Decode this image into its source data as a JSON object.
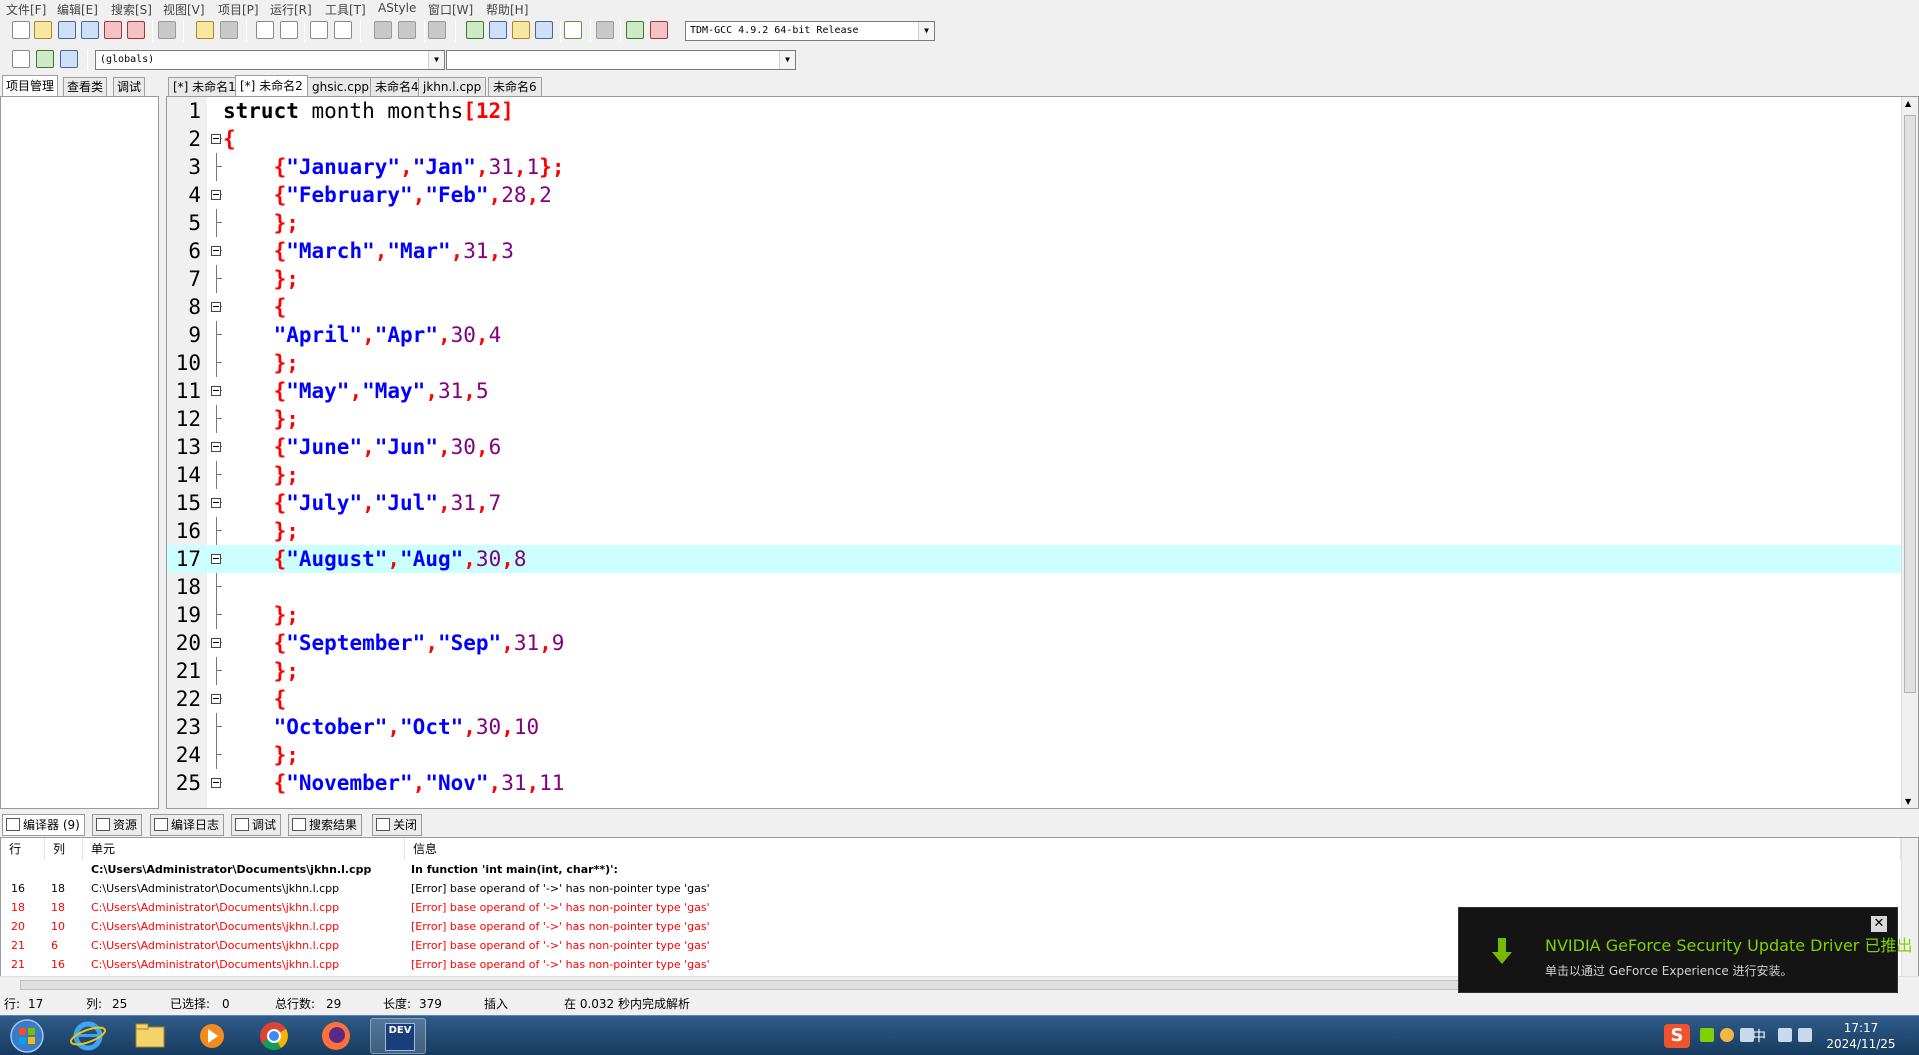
{
  "menu": [
    "文件[F]",
    "编辑[E]",
    "搜索[S]",
    "视图[V]",
    "项目[P]",
    "运行[R]",
    "工具[T]",
    "AStyle",
    "窗口[W]",
    "帮助[H]"
  ],
  "toolbar": {
    "compiler_select": "TDM-GCC 4.9.2 64-bit Release",
    "scope_select": "(globals)",
    "function_select": ""
  },
  "left_tabs": [
    "项目管理",
    "查看类",
    "调试"
  ],
  "editor_tabs": [
    "[*] 未命名1",
    "[*] 未命名2",
    "ghsic.cpp",
    "未命名4",
    "jkhn.l.cpp",
    "未命名6"
  ],
  "editor": {
    "highlight_line": 17,
    "lines": [
      {
        "n": "1",
        "fold": false
      },
      {
        "n": "2",
        "fold": true
      },
      {
        "n": "3",
        "fold": false
      },
      {
        "n": "4",
        "fold": true
      },
      {
        "n": "5",
        "fold": false
      },
      {
        "n": "6",
        "fold": true
      },
      {
        "n": "7",
        "fold": false
      },
      {
        "n": "8",
        "fold": true
      },
      {
        "n": "9",
        "fold": false
      },
      {
        "n": "10",
        "fold": false
      },
      {
        "n": "11",
        "fold": true
      },
      {
        "n": "12",
        "fold": false
      },
      {
        "n": "13",
        "fold": true
      },
      {
        "n": "14",
        "fold": false
      },
      {
        "n": "15",
        "fold": true
      },
      {
        "n": "16",
        "fold": false
      },
      {
        "n": "17",
        "fold": true
      },
      {
        "n": "18",
        "fold": false
      },
      {
        "n": "19",
        "fold": false
      },
      {
        "n": "20",
        "fold": true
      },
      {
        "n": "21",
        "fold": false
      },
      {
        "n": "22",
        "fold": true
      },
      {
        "n": "23",
        "fold": false
      },
      {
        "n": "24",
        "fold": false
      },
      {
        "n": "25",
        "fold": true
      }
    ],
    "code": [
      [
        [
          "kw",
          "struct"
        ],
        [
          "id",
          " month months"
        ],
        [
          "sym",
          "[12]"
        ]
      ],
      [
        [
          "sym",
          "{"
        ]
      ],
      [
        [
          "id",
          "    "
        ],
        [
          "sym",
          "{"
        ],
        [
          "str",
          "\"January\""
        ],
        [
          "sym",
          ","
        ],
        [
          "str",
          "\"Jan\""
        ],
        [
          "sym",
          ","
        ],
        [
          "num",
          "31"
        ],
        [
          "sym",
          ","
        ],
        [
          "num",
          "1"
        ],
        [
          "sym",
          "};"
        ]
      ],
      [
        [
          "id",
          "    "
        ],
        [
          "sym",
          "{"
        ],
        [
          "str",
          "\"February\""
        ],
        [
          "sym",
          ","
        ],
        [
          "str",
          "\"Feb\""
        ],
        [
          "sym",
          ","
        ],
        [
          "num",
          "28"
        ],
        [
          "sym",
          ","
        ],
        [
          "num",
          "2"
        ]
      ],
      [
        [
          "id",
          "    "
        ],
        [
          "sym",
          "};"
        ]
      ],
      [
        [
          "id",
          "    "
        ],
        [
          "sym",
          "{"
        ],
        [
          "str",
          "\"March\""
        ],
        [
          "sym",
          ","
        ],
        [
          "str",
          "\"Mar\""
        ],
        [
          "sym",
          ","
        ],
        [
          "num",
          "31"
        ],
        [
          "sym",
          ","
        ],
        [
          "num",
          "3"
        ]
      ],
      [
        [
          "id",
          "    "
        ],
        [
          "sym",
          "};"
        ]
      ],
      [
        [
          "id",
          "    "
        ],
        [
          "sym",
          "{"
        ]
      ],
      [
        [
          "id",
          "    "
        ],
        [
          "str",
          "\"April\""
        ],
        [
          "sym",
          ","
        ],
        [
          "str",
          "\"Apr\""
        ],
        [
          "sym",
          ","
        ],
        [
          "num",
          "30"
        ],
        [
          "sym",
          ","
        ],
        [
          "num",
          "4"
        ]
      ],
      [
        [
          "id",
          "    "
        ],
        [
          "sym",
          "};"
        ]
      ],
      [
        [
          "id",
          "    "
        ],
        [
          "sym",
          "{"
        ],
        [
          "str",
          "\"May\""
        ],
        [
          "sym",
          ","
        ],
        [
          "str",
          "\"May\""
        ],
        [
          "sym",
          ","
        ],
        [
          "num",
          "31"
        ],
        [
          "sym",
          ","
        ],
        [
          "num",
          "5"
        ]
      ],
      [
        [
          "id",
          "    "
        ],
        [
          "sym",
          "};"
        ]
      ],
      [
        [
          "id",
          "    "
        ],
        [
          "sym",
          "{"
        ],
        [
          "str",
          "\"June\""
        ],
        [
          "sym",
          ","
        ],
        [
          "str",
          "\"Jun\""
        ],
        [
          "sym",
          ","
        ],
        [
          "num",
          "30"
        ],
        [
          "sym",
          ","
        ],
        [
          "num",
          "6"
        ]
      ],
      [
        [
          "id",
          "    "
        ],
        [
          "sym",
          "};"
        ]
      ],
      [
        [
          "id",
          "    "
        ],
        [
          "sym",
          "{"
        ],
        [
          "str",
          "\"July\""
        ],
        [
          "sym",
          ","
        ],
        [
          "str",
          "\"Jul\""
        ],
        [
          "sym",
          ","
        ],
        [
          "num",
          "31"
        ],
        [
          "sym",
          ","
        ],
        [
          "num",
          "7"
        ]
      ],
      [
        [
          "id",
          "    "
        ],
        [
          "sym",
          "};"
        ]
      ],
      [
        [
          "id",
          "    "
        ],
        [
          "sym",
          "{"
        ],
        [
          "str",
          "\"August\""
        ],
        [
          "sym",
          ","
        ],
        [
          "str",
          "\"Aug\""
        ],
        [
          "sym",
          ","
        ],
        [
          "num",
          "30"
        ],
        [
          "sym",
          ","
        ],
        [
          "num",
          "8"
        ]
      ],
      [],
      [
        [
          "id",
          "    "
        ],
        [
          "sym",
          "};"
        ]
      ],
      [
        [
          "id",
          "    "
        ],
        [
          "sym",
          "{"
        ],
        [
          "str",
          "\"September\""
        ],
        [
          "sym",
          ","
        ],
        [
          "str",
          "\"Sep\""
        ],
        [
          "sym",
          ","
        ],
        [
          "num",
          "31"
        ],
        [
          "sym",
          ","
        ],
        [
          "num",
          "9"
        ]
      ],
      [
        [
          "id",
          "    "
        ],
        [
          "sym",
          "};"
        ]
      ],
      [
        [
          "id",
          "    "
        ],
        [
          "sym",
          "{"
        ]
      ],
      [
        [
          "id",
          "    "
        ],
        [
          "str",
          "\"October\""
        ],
        [
          "sym",
          ","
        ],
        [
          "str",
          "\"Oct\""
        ],
        [
          "sym",
          ","
        ],
        [
          "num",
          "30"
        ],
        [
          "sym",
          ","
        ],
        [
          "num",
          "10"
        ]
      ],
      [
        [
          "id",
          "    "
        ],
        [
          "sym",
          "};"
        ]
      ],
      [
        [
          "id",
          "    "
        ],
        [
          "sym",
          "{"
        ],
        [
          "str",
          "\"November\""
        ],
        [
          "sym",
          ","
        ],
        [
          "str",
          "\"Nov\""
        ],
        [
          "sym",
          ","
        ],
        [
          "num",
          "31"
        ],
        [
          "sym",
          ","
        ],
        [
          "num",
          "11"
        ]
      ]
    ]
  },
  "bottom_tabs": [
    "编译器 (9)",
    "资源",
    "编译日志",
    "调试",
    "搜索结果",
    "关闭"
  ],
  "messages": {
    "headers": [
      "行",
      "列",
      "单元",
      "信息"
    ],
    "rows": [
      {
        "line": "",
        "col": "",
        "unit": "C:\\Users\\Administrator\\Documents\\jkhn.l.cpp",
        "msg": "In function 'int main(int, char**)':",
        "kind": "bold"
      },
      {
        "line": "16",
        "col": "18",
        "unit": "C:\\Users\\Administrator\\Documents\\jkhn.l.cpp",
        "msg": "[Error] base operand of '->' has non-pointer type 'gas'",
        "kind": "normal"
      },
      {
        "line": "18",
        "col": "18",
        "unit": "C:\\Users\\Administrator\\Documents\\jkhn.l.cpp",
        "msg": "[Error] base operand of '->' has non-pointer type 'gas'",
        "kind": "err"
      },
      {
        "line": "20",
        "col": "10",
        "unit": "C:\\Users\\Administrator\\Documents\\jkhn.l.cpp",
        "msg": "[Error] base operand of '->' has non-pointer type 'gas'",
        "kind": "err"
      },
      {
        "line": "21",
        "col": "6",
        "unit": "C:\\Users\\Administrator\\Documents\\jkhn.l.cpp",
        "msg": "[Error] base operand of '->' has non-pointer type 'gas'",
        "kind": "err"
      },
      {
        "line": "21",
        "col": "16",
        "unit": "C:\\Users\\Administrator\\Documents\\jkhn.l.cpp",
        "msg": "[Error] base operand of '->' has non-pointer type 'gas'",
        "kind": "err"
      }
    ]
  },
  "status": {
    "row_label": "行:",
    "row": "17",
    "col_label": "列:",
    "col": "25",
    "sel_label": "已选择:",
    "sel": "0",
    "total_label": "总行数:",
    "total": "29",
    "len_label": "长度:",
    "len": "379",
    "mode": "插入",
    "parse": "在 0.032 秒内完成解析"
  },
  "notification": {
    "title": "NVIDIA GeForce Security Update Driver 已推出",
    "body": "单击以通过 GeForce Experience 进行安装。",
    "close": "✕"
  },
  "taskbar": {
    "apps": [
      "start",
      "ie",
      "explorer",
      "media",
      "chrome",
      "firefox",
      "devcpp"
    ],
    "dev_label": "DEV",
    "time": "17:17",
    "date": "2024/11/25",
    "ime": "中"
  },
  "colors": {
    "highlight": "#ccffff",
    "error": "#ff0000",
    "keyword": "#000000",
    "string": "#0000ff",
    "number": "#800080",
    "symbol": "#ff0000",
    "toast_title": "#7fd100"
  }
}
